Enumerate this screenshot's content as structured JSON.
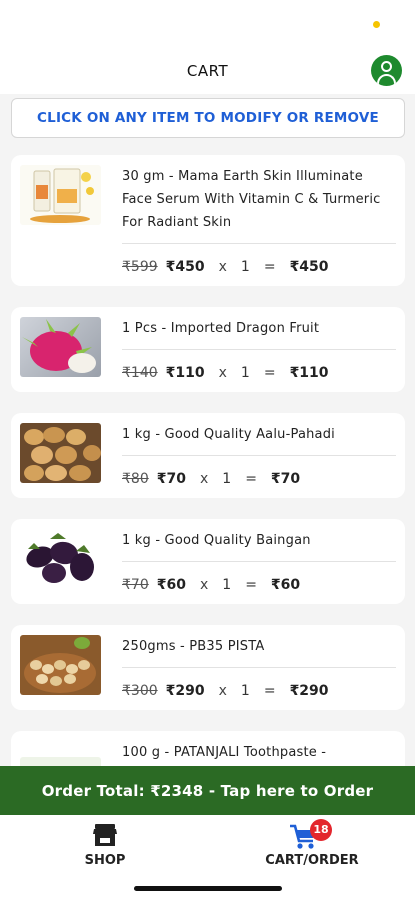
{
  "header": {
    "title": "CART"
  },
  "notice": "CLICK ON ANY ITEM TO MODIFY OR REMOVE",
  "currency": "₹",
  "items": [
    {
      "name": "30 gm - Mama Earth Skin Illuminate Face Serum With Vitamin C & Turmeric For Radiant Skin",
      "mrp": "₹599",
      "price": "₹450",
      "op": "x",
      "qty": "1",
      "eq": "=",
      "total": "₹450",
      "image": "serum"
    },
    {
      "name": "1 Pcs - Imported Dragon Fruit",
      "mrp": "₹140",
      "price": "₹110",
      "op": "x",
      "qty": "1",
      "eq": "=",
      "total": "₹110",
      "image": "dragon-fruit"
    },
    {
      "name": "1 kg - Good Quality Aalu-Pahadi",
      "mrp": "₹80",
      "price": "₹70",
      "op": "x",
      "qty": "1",
      "eq": "=",
      "total": "₹70",
      "image": "potato"
    },
    {
      "name": "1 kg - Good Quality Baingan",
      "mrp": "₹70",
      "price": "₹60",
      "op": "x",
      "qty": "1",
      "eq": "=",
      "total": "₹60",
      "image": "baingan"
    },
    {
      "name": "250gms - PB35 PISTA",
      "mrp": "₹300",
      "price": "₹290",
      "op": "x",
      "qty": "1",
      "eq": "=",
      "total": "₹290",
      "image": "pista"
    },
    {
      "name": "100 g - PATANJALI Toothpaste -",
      "mrp": "",
      "price": "",
      "op": "",
      "qty": "",
      "eq": "",
      "total": "",
      "image": "toothpaste"
    }
  ],
  "order_bar": "Order Total: ₹2348 - Tap here to Order",
  "tabs": {
    "shop": {
      "label": "SHOP",
      "icon": "store-icon"
    },
    "cart": {
      "label": "CART/ORDER",
      "icon": "cart-icon",
      "badge": "18"
    }
  },
  "colors": {
    "brand_green": "#2b6a24",
    "profile_green": "#1e8a2e",
    "notice_blue": "#1f5fd6",
    "badge_red": "#e3262d",
    "status_dot": "#f5c400"
  }
}
